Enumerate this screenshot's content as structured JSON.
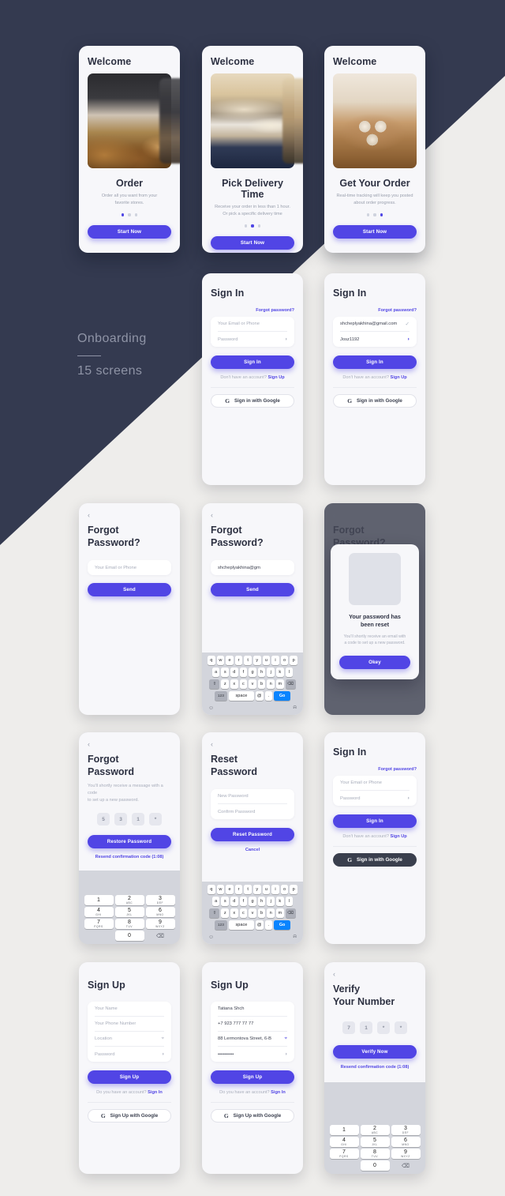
{
  "meta": {
    "section_label": "Onboarding",
    "section_count": "15 screens"
  },
  "onboarding": {
    "welcome": "Welcome",
    "start_now": "Start Now",
    "slides": [
      {
        "title": "Order",
        "subtitle_line1": "Order all you want from your",
        "subtitle_line2": "favorite stores.",
        "active_dot": 0
      },
      {
        "title": "Pick Delivery Time",
        "subtitle_line1": "Receive your order in less than 1 hour.",
        "subtitle_line2": "Or pick a specific delivery time",
        "active_dot": 1
      },
      {
        "title": "Get Your Order",
        "subtitle_line1": "Real-time tracking will keep you posted",
        "subtitle_line2": "about order progress.",
        "active_dot": 2
      }
    ]
  },
  "signin": {
    "title": "Sign In",
    "forgot_link": "Forgot password?",
    "email_placeholder": "Your Email or Phone",
    "password_placeholder": "Password",
    "email_value": "shcheplyakhina@gmail.com",
    "password_value": "Josz1192",
    "submit": "Sign In",
    "no_account_prefix": "Don't have an account?",
    "signup_link": "Sign Up",
    "google": "Sign in with Google",
    "google_icon": "google-g-icon"
  },
  "forgot": {
    "title_line1": "Forgot",
    "title_line2": "Password?",
    "email_placeholder": "Your Email or Phone",
    "email_value": "shcheplyakhina@gm",
    "send": "Send",
    "back_icon": "chevron-left-icon"
  },
  "reset_modal": {
    "title_line1": "Your password has",
    "title_line2": "been reset",
    "body_line1": "You'll shortly receive an email with",
    "body_line2": "a code to set up a new password.",
    "okey": "Okey"
  },
  "forgot_code": {
    "title_line1": "Forgot",
    "title_line2": "Password",
    "hint_line1": "You'll shortly receive a message with a code",
    "hint_line2": "to set up a new password.",
    "code": [
      "5",
      "3",
      "1",
      "*"
    ],
    "submit": "Restore Password",
    "resend": "Resend confirmation code (1:08)"
  },
  "reset_password": {
    "title_line1": "Reset",
    "title_line2": "Password",
    "new_placeholder": "New Password",
    "confirm_placeholder": "Confirm Password",
    "submit": "Reset Password",
    "cancel": "Cancel"
  },
  "signup": {
    "title": "Sign Up",
    "name_placeholder": "Your Name",
    "phone_placeholder": "Your Phone Number",
    "location_placeholder": "Location",
    "password_placeholder": "Password",
    "name_value": "Tatiana Shch",
    "phone_value": "+7 923 777 77 77",
    "location_value": "88 Lermontova Street, 6-B",
    "password_value": "••••••••••",
    "submit": "Sign Up",
    "have_account_prefix": "Do you have an account?",
    "signin_link": "Sign In",
    "google": "Sign Up with Google"
  },
  "verify": {
    "title_line1": "Verify",
    "title_line2": "Your Number",
    "code": [
      "7",
      "1",
      "*",
      "*"
    ],
    "submit": "Verify Now",
    "resend": "Resend confirmation code (1:08)"
  },
  "keyboard": {
    "row1": [
      "q",
      "w",
      "e",
      "r",
      "t",
      "y",
      "u",
      "i",
      "o",
      "p"
    ],
    "row2": [
      "a",
      "s",
      "d",
      "f",
      "g",
      "h",
      "j",
      "k",
      "l"
    ],
    "row3": [
      "z",
      "x",
      "c",
      "v",
      "b",
      "n",
      "m"
    ],
    "shift": "shift-icon",
    "backspace": "backspace-icon",
    "numbers": "123",
    "space": "space",
    "at": "@",
    "dot": ".",
    "go": "Go",
    "emoji": "emoji-icon",
    "mic": "microphone-icon"
  },
  "keypad": {
    "keys": [
      {
        "n": "1",
        "l": ""
      },
      {
        "n": "2",
        "l": "ABC"
      },
      {
        "n": "3",
        "l": "DEF"
      },
      {
        "n": "4",
        "l": "GHI"
      },
      {
        "n": "5",
        "l": "JKL"
      },
      {
        "n": "6",
        "l": "MNO"
      },
      {
        "n": "7",
        "l": "PQRS"
      },
      {
        "n": "8",
        "l": "TUV"
      },
      {
        "n": "9",
        "l": "WXYZ"
      },
      {
        "n": "0",
        "l": ""
      }
    ],
    "delete": "backspace-icon"
  },
  "colors": {
    "accent": "#5145e5",
    "dark_bg": "#343a50",
    "light_bg": "#eeedeb",
    "card_bg": "#f7f7fa",
    "keyboard_bg": "#d3d5dc",
    "go_blue": "#0a84ff"
  }
}
